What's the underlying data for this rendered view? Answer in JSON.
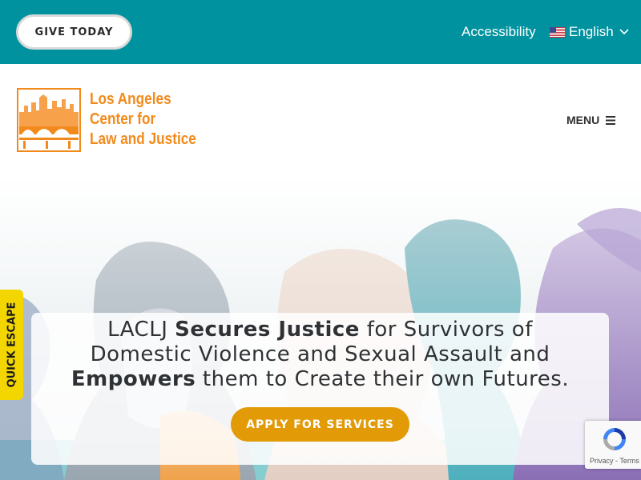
{
  "topbar": {
    "give_label": "GIVE TODAY",
    "accessibility_label": "Accessibility",
    "language_label": "English",
    "background_color": "#00939f"
  },
  "header": {
    "logo_lines": [
      "Los Angeles",
      "Center for",
      "Law and Justice"
    ],
    "menu_label": "MENU",
    "brand_color": "#f28a1b"
  },
  "hero": {
    "headline": {
      "l1a": "LACLJ ",
      "l1b": "Secures Justice",
      "l1c": " for Survivors of",
      "l2": "Domestic Violence and Sexual Assault and",
      "l3a": "Empowers",
      "l3b": " them to Create their own Futures."
    },
    "apply_label": "APPLY FOR SERVICES",
    "apply_color": "#e29a07"
  },
  "quick_escape": {
    "label": "QUICK ESCAPE",
    "color": "#f3d600"
  },
  "recaptcha": {
    "text": "Privacy - Terms"
  },
  "icons": [
    "us-flag-icon",
    "chevron-down-icon",
    "hamburger-icon",
    "recaptcha-icon"
  ]
}
